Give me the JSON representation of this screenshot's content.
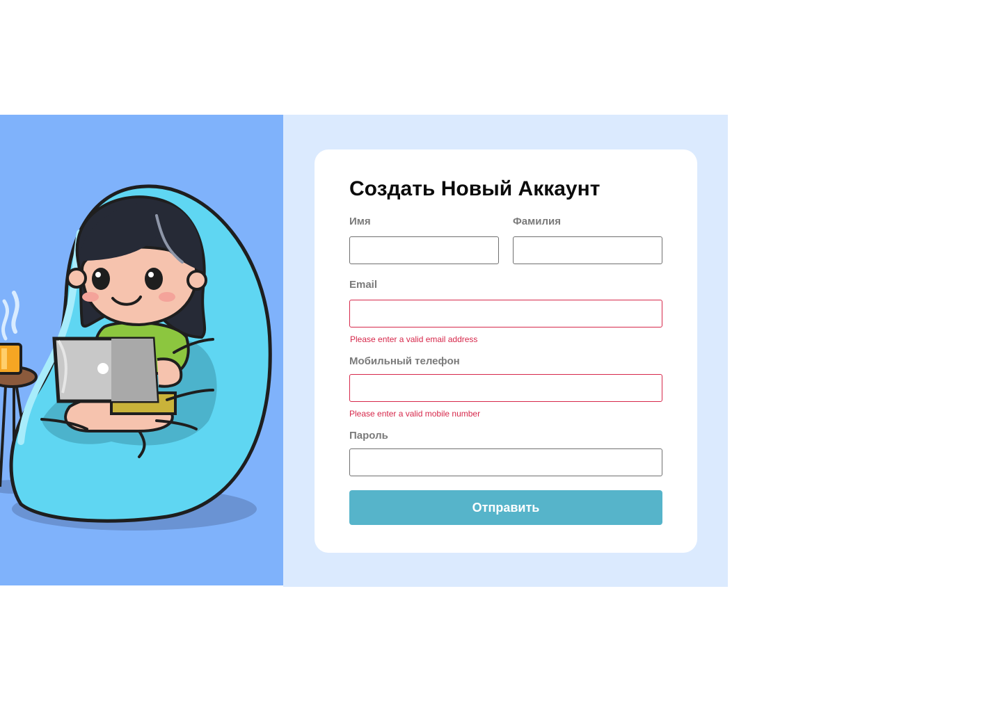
{
  "form": {
    "title": "Создать Новый Аккаунт",
    "fields": {
      "first_name": {
        "label": "Имя",
        "value": "",
        "placeholder": ""
      },
      "last_name": {
        "label": "Фамилия",
        "value": "",
        "placeholder": ""
      },
      "email": {
        "label": "Email",
        "value": "",
        "placeholder": "",
        "error": "Please enter a valid email address"
      },
      "phone": {
        "label": "Мобильный телефон",
        "value": "",
        "placeholder": "",
        "error": "Please enter a valid mobile number"
      },
      "password": {
        "label": "Пароль",
        "value": "",
        "placeholder": ""
      }
    },
    "submit_label": "Отправить"
  },
  "colors": {
    "illustration_background": "#7fb2fb",
    "form_background": "#dbeafe",
    "card_background": "#ffffff",
    "accent_button": "#56b4ca",
    "error": "#d6274a",
    "label": "#7a7a7a"
  },
  "illustration": {
    "subject": "girl-on-beanbag-with-laptop-illustration"
  }
}
